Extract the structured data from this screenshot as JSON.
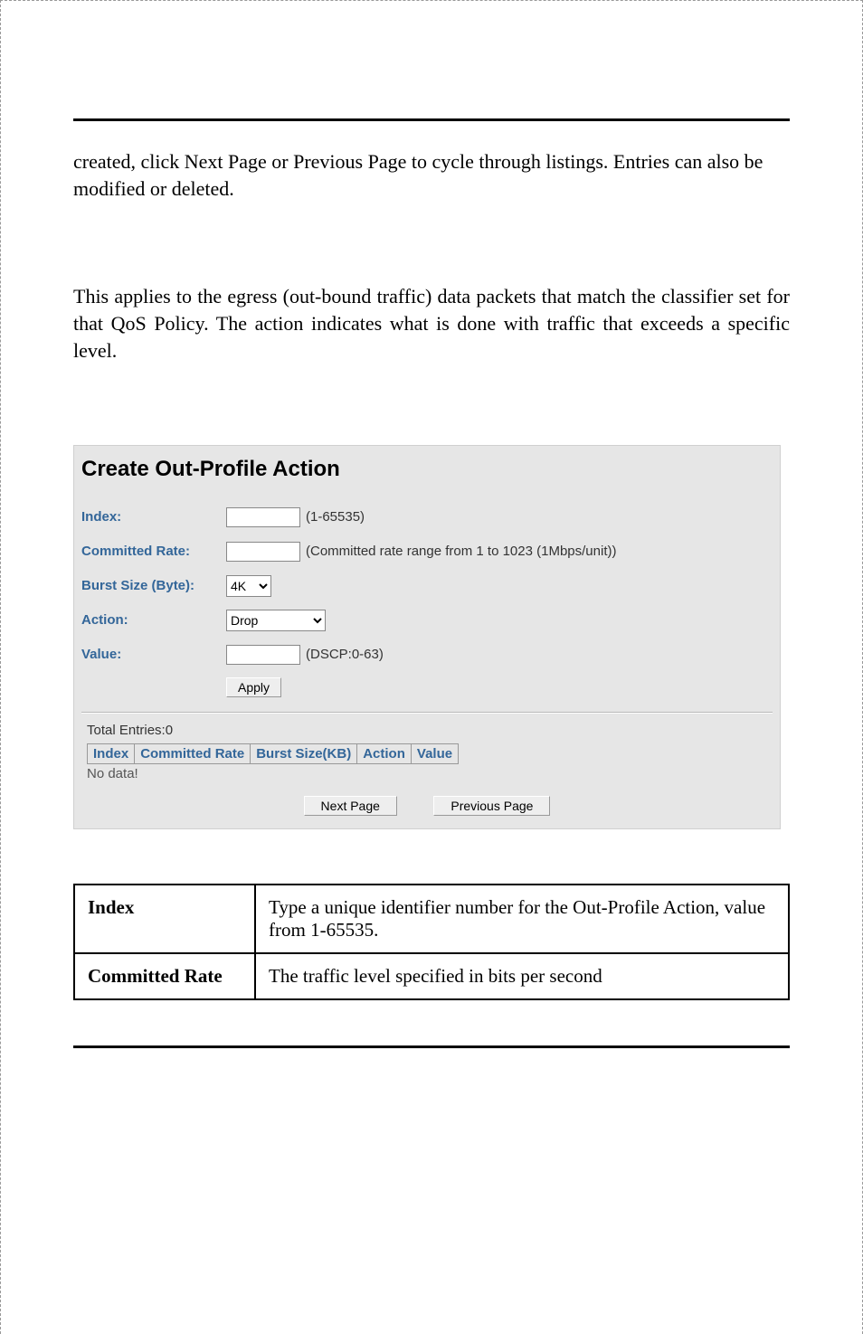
{
  "intro1": "created, click Next Page or Previous Page to cycle through listings. Entries can also be modified or deleted.",
  "intro2": "This applies to the egress (out-bound traffic) data packets that match the classifier set for that QoS Policy.  The action indicates what is done with traffic that exceeds a specific level.",
  "panel": {
    "title": "Create Out-Profile Action",
    "labels": {
      "index": "Index:",
      "committed_rate": "Committed Rate:",
      "burst_size": "Burst Size (Byte):",
      "action": "Action:",
      "value": "Value:"
    },
    "hints": {
      "index": "(1-65535)",
      "committed_rate": "(Committed rate range from 1 to 1023 (1Mbps/unit))",
      "value": "(DSCP:0-63)"
    },
    "selected": {
      "burst_size": "4K",
      "action": "Drop"
    },
    "buttons": {
      "apply": "Apply",
      "next": "Next Page",
      "prev": "Previous Page"
    },
    "total_entries": "Total Entries:0",
    "cols": {
      "index": "Index",
      "committed_rate": "Committed Rate",
      "burst_size": "Burst Size(KB)",
      "action": "Action",
      "value": "Value"
    },
    "no_data": "No data!"
  },
  "desc": {
    "index": {
      "k": "Index",
      "v": "Type a unique identifier number for the Out-Profile Action, value from 1-65535."
    },
    "committed": {
      "k": "Committed Rate",
      "v": "The traffic level specified in bits per second"
    }
  }
}
